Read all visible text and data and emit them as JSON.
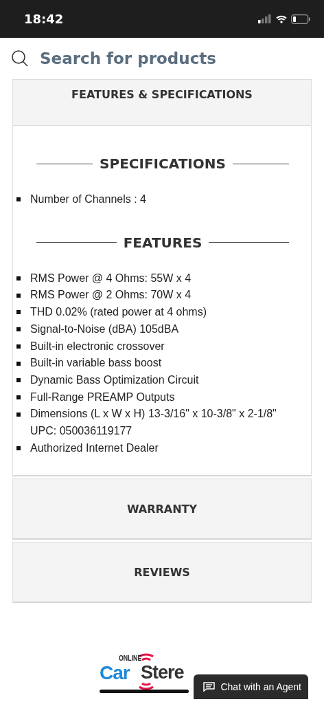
{
  "status_bar": {
    "time": "18:42"
  },
  "search": {
    "placeholder": "Search for products"
  },
  "sections": [
    {
      "title": "FEATURES & SPECIFICATIONS",
      "expanded": true,
      "groups": [
        {
          "heading": "SPECIFICATIONS",
          "items": [
            {
              "text": "Number of Channels : 4",
              "bullet": true
            }
          ]
        },
        {
          "heading": "FEATURES",
          "items": [
            {
              "text": "RMS Power @ 4 Ohms: 55W x 4",
              "bullet": true
            },
            {
              "text": "RMS Power @ 2 Ohms: 70W x 4",
              "bullet": true
            },
            {
              "text": "THD 0.02% (rated power at 4 ohms)",
              "bullet": true
            },
            {
              "text": "Signal-to-Noise (dBA) 105dBA",
              "bullet": true
            },
            {
              "text": "Built-in electronic crossover",
              "bullet": true
            },
            {
              "text": "Built-in variable bass boost",
              "bullet": true
            },
            {
              "text": "Dynamic Bass Optimization Circuit",
              "bullet": true
            },
            {
              "text": "Full-Range PREAMP Outputs",
              "bullet": true
            },
            {
              "text": "Dimensions (L x W x H) 13-3/16\" x 10-3/8\" x 2-1/8\"",
              "bullet": true
            },
            {
              "text": "UPC: 050036119177",
              "bullet": false
            },
            {
              "text": "Authorized Internet Dealer",
              "bullet": true
            }
          ]
        }
      ]
    },
    {
      "title": "WARRANTY",
      "expanded": false
    },
    {
      "title": "REVIEWS",
      "expanded": false
    }
  ],
  "logo": {
    "small": "ONLINE",
    "first": "Car",
    "second": "Stere"
  },
  "chat_button": {
    "label": "Chat with an Agent"
  }
}
